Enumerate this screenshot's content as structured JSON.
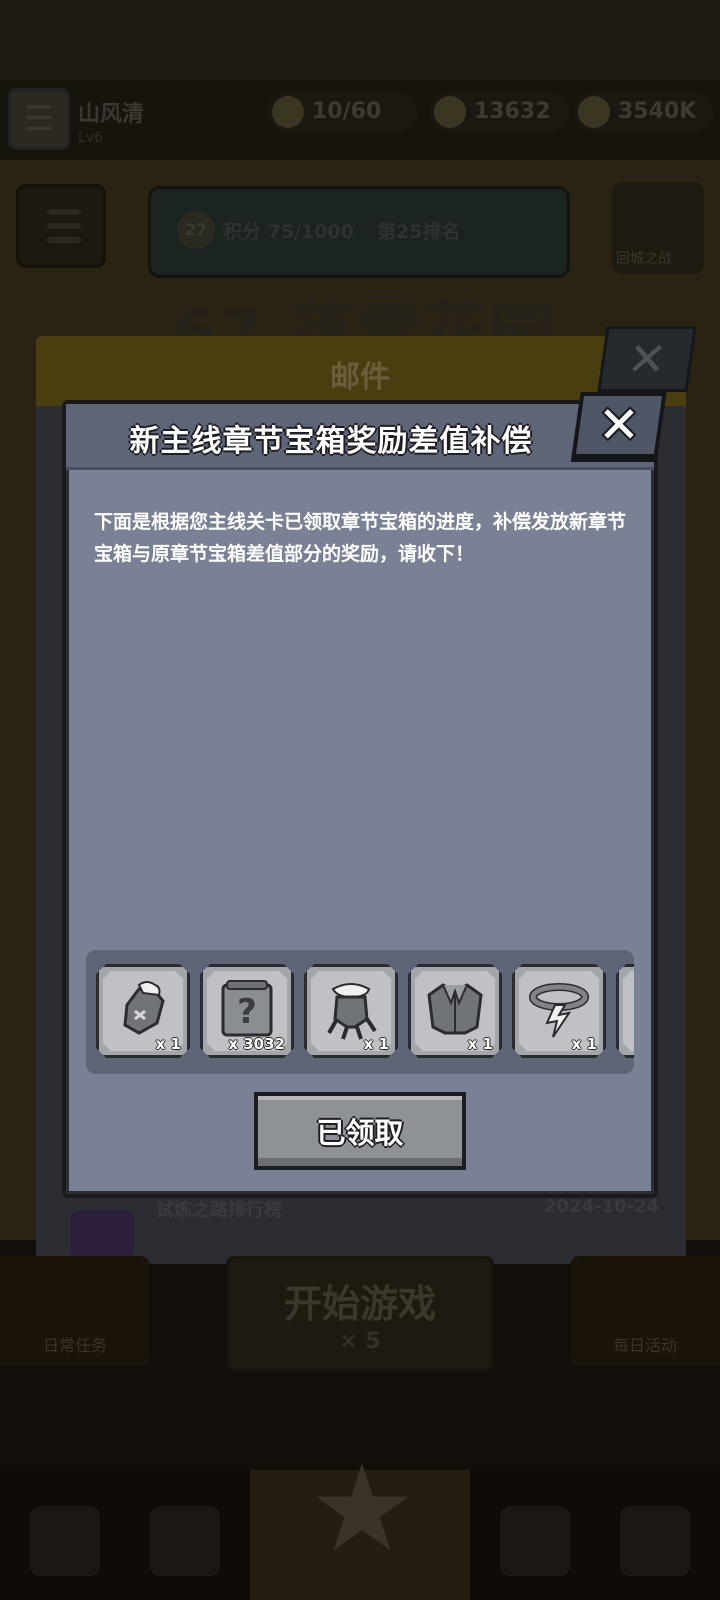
{
  "background": {
    "player": {
      "name": "山风清",
      "level": "Lv6"
    },
    "resources": [
      {
        "name": "stamina",
        "value": "10/60"
      },
      {
        "name": "gems",
        "value": "13632"
      },
      {
        "name": "coins",
        "value": "3540K"
      }
    ],
    "progress": {
      "badge": "27",
      "text": "积分 75/1000",
      "rank": "第25排名"
    },
    "shield_label": "回城之战",
    "stage_title": "67.落雪花园",
    "mail": {
      "title": "邮件",
      "row_title": "试炼之路排行榜",
      "row_date": "2024-10-24"
    },
    "bottom": {
      "left_label": "日常任务",
      "start_label": "开始游戏",
      "start_cost": "× 5",
      "right_label": "每日活动"
    }
  },
  "modal": {
    "title": "新主线章节宝箱奖励差值补偿",
    "description": "下面是根据您主线关卡已领取章节宝箱的进度，补偿发放新章节宝箱与原章节宝箱差值部分的奖励，请收下！",
    "close_glyph": "✕",
    "rewards": [
      {
        "icon": "glove-icon",
        "qty": "x 1"
      },
      {
        "icon": "mystery-scroll-icon",
        "qty": "x 3032"
      },
      {
        "icon": "claw-icon",
        "qty": "x 1"
      },
      {
        "icon": "jacket-icon",
        "qty": "x 1"
      },
      {
        "icon": "belt-icon",
        "qty": "x 1"
      }
    ],
    "claim_label": "已领取",
    "colors": {
      "panel": "#7a8194",
      "header": "#5e6577",
      "button": "#8e9196"
    }
  }
}
